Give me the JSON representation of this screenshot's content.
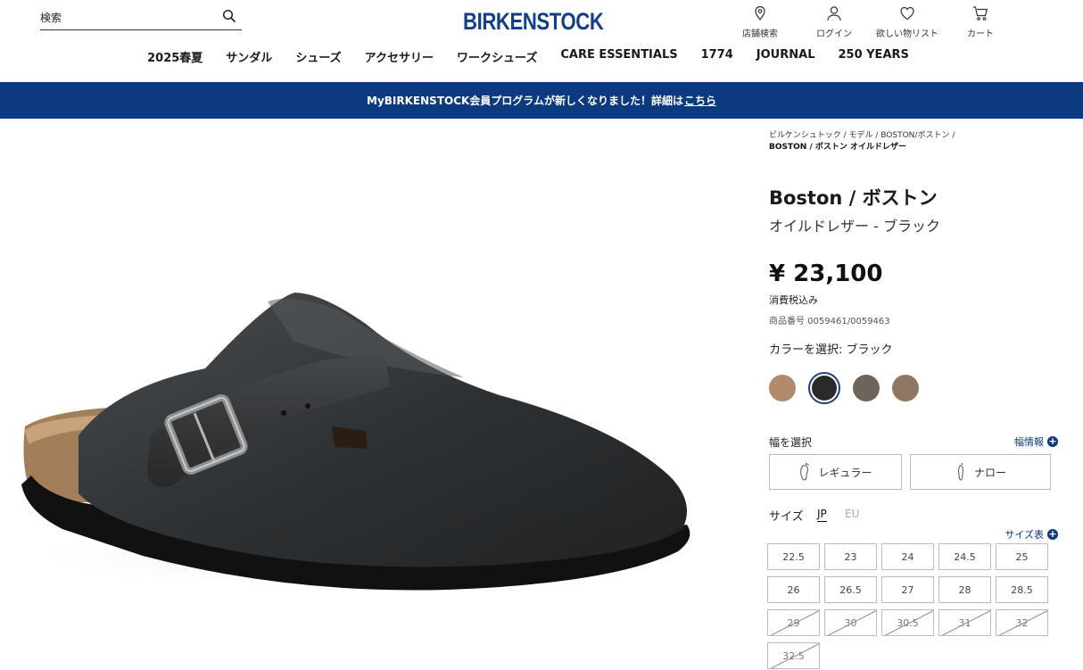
{
  "header": {
    "search": {
      "placeholder": "検索"
    },
    "logo": "BIRKENSTOCK",
    "utilities": {
      "store": "店舗検索",
      "login": "ログイン",
      "wishlist": "欲しい物リスト",
      "cart": "カート"
    },
    "nav": [
      "2025春夏",
      "サンダル",
      "シューズ",
      "アクセサリー",
      "ワークシューズ",
      "CARE ESSENTIALS",
      "1774",
      "JOURNAL",
      "250 YEARS"
    ]
  },
  "banner": {
    "text": "MyBIRKENSTOCK会員プログラムが新しくなりました！詳細は",
    "link": "こちら"
  },
  "breadcrumb": {
    "items": [
      "ビルケンシュトック",
      "モデル",
      "BOSTON/ボストン"
    ],
    "current": "BOSTON / ボストン オイルドレザー"
  },
  "product": {
    "title": "Boston / ボストン",
    "subtitle": "オイルドレザー - ブラック",
    "price": "¥ 23,100",
    "tax_note": "消費税込み",
    "sku": "商品番号 0059461/0059463",
    "color_label": "カラーを選択: ブラック",
    "colors": [
      {
        "name": "tobacco",
        "hex": "#b08a6a"
      },
      {
        "name": "black",
        "hex": "#2a2a2a",
        "selected": true
      },
      {
        "name": "grey",
        "hex": "#6e645c"
      },
      {
        "name": "mink",
        "hex": "#8f7863"
      }
    ],
    "width": {
      "label": "幅を選択",
      "info": "幅情報",
      "options": [
        "レギュラー",
        "ナロー"
      ]
    },
    "size": {
      "label": "サイズ",
      "jp": "JP",
      "eu": "EU",
      "chart": "サイズ表",
      "options": [
        {
          "v": "22.5",
          "available": true
        },
        {
          "v": "23",
          "available": true
        },
        {
          "v": "24",
          "available": true
        },
        {
          "v": "24.5",
          "available": true
        },
        {
          "v": "25",
          "available": true
        },
        {
          "v": "26",
          "available": true
        },
        {
          "v": "26.5",
          "available": true
        },
        {
          "v": "27",
          "available": true
        },
        {
          "v": "28",
          "available": true
        },
        {
          "v": "28.5",
          "available": true
        },
        {
          "v": "29",
          "available": false
        },
        {
          "v": "30",
          "available": false
        },
        {
          "v": "30.5",
          "available": false
        },
        {
          "v": "31",
          "available": false
        },
        {
          "v": "32",
          "available": false
        },
        {
          "v": "32.5",
          "available": false
        }
      ]
    }
  }
}
